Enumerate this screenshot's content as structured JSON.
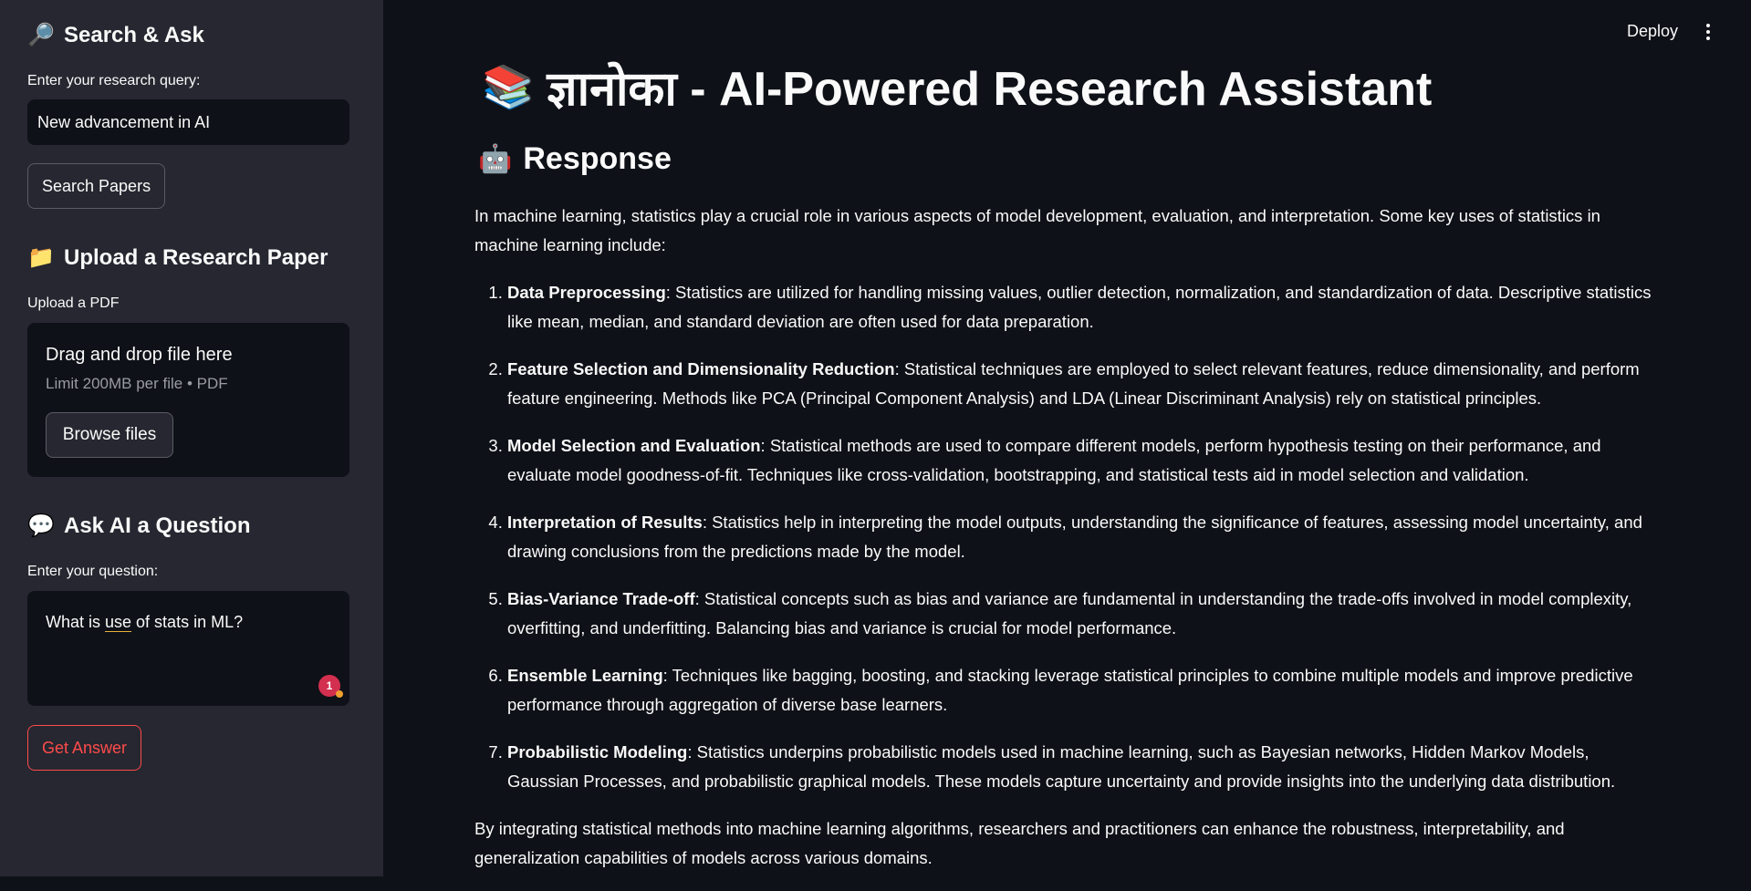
{
  "sidebar": {
    "search_heading": "Search & Ask",
    "search_icon": "magnifier-icon",
    "query_label": "Enter your research query:",
    "query_value": "New advancement in AI",
    "search_button": "Search Papers",
    "upload_heading": "Upload a Research Paper",
    "upload_icon": "folder-icon",
    "upload_label": "Upload a PDF",
    "drag_drop": "Drag and drop file here",
    "limit": "Limit 200MB per file • PDF",
    "browse_button": "Browse files",
    "ask_heading": "Ask AI a Question",
    "ask_icon": "speech-bubble-icon",
    "question_label": "Enter your question:",
    "question_pre": "What is ",
    "question_underlined": "use",
    "question_post": " of stats in ML?",
    "badge_count": "1",
    "get_answer_button": "Get Answer"
  },
  "header": {
    "deploy": "Deploy"
  },
  "main": {
    "title": "ज्ञानोका - AI-Powered Research Assistant",
    "title_icon": "books-icon",
    "response_heading": "Response",
    "response_icon": "robot-icon",
    "intro": "In machine learning, statistics play a crucial role in various aspects of model development, evaluation, and interpretation. Some key uses of statistics in machine learning include:",
    "items": [
      {
        "term": "Data Preprocessing",
        "text": ": Statistics are utilized for handling missing values, outlier detection, normalization, and standardization of data. Descriptive statistics like mean, median, and standard deviation are often used for data preparation."
      },
      {
        "term": "Feature Selection and Dimensionality Reduction",
        "text": ": Statistical techniques are employed to select relevant features, reduce dimensionality, and perform feature engineering. Methods like PCA (Principal Component Analysis) and LDA (Linear Discriminant Analysis) rely on statistical principles."
      },
      {
        "term": "Model Selection and Evaluation",
        "text": ": Statistical methods are used to compare different models, perform hypothesis testing on their performance, and evaluate model goodness-of-fit. Techniques like cross-validation, bootstrapping, and statistical tests aid in model selection and validation."
      },
      {
        "term": "Interpretation of Results",
        "text": ": Statistics help in interpreting the model outputs, understanding the significance of features, assessing model uncertainty, and drawing conclusions from the predictions made by the model."
      },
      {
        "term": "Bias-Variance Trade-off",
        "text": ": Statistical concepts such as bias and variance are fundamental in understanding the trade-offs involved in model complexity, overfitting, and underfitting. Balancing bias and variance is crucial for model performance."
      },
      {
        "term": "Ensemble Learning",
        "text": ": Techniques like bagging, boosting, and stacking leverage statistical principles to combine multiple models and improve predictive performance through aggregation of diverse base learners."
      },
      {
        "term": "Probabilistic Modeling",
        "text": ": Statistics underpins probabilistic models used in machine learning, such as Bayesian networks, Hidden Markov Models, Gaussian Processes, and probabilistic graphical models. These models capture uncertainty and provide insights into the underlying data distribution."
      }
    ],
    "conclusion": "By integrating statistical methods into machine learning algorithms, researchers and practitioners can enhance the robustness, interpretability, and generalization capabilities of models across various domains."
  }
}
